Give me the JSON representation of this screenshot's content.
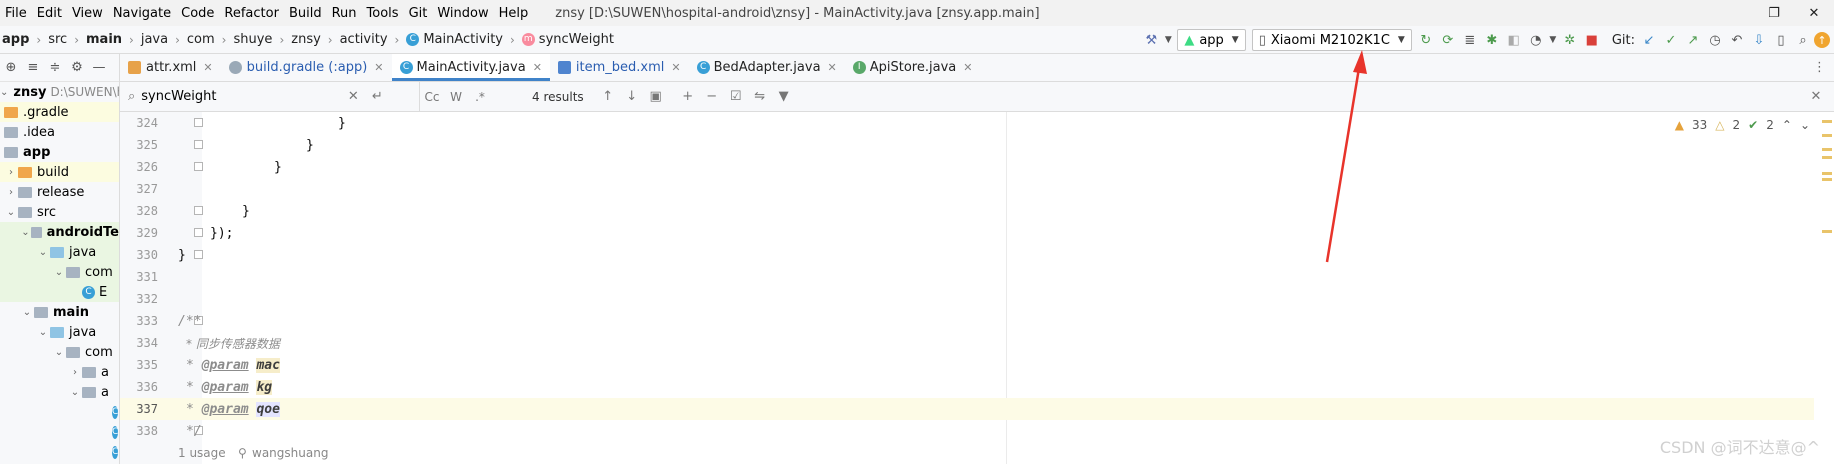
{
  "menubar": {
    "items": [
      "File",
      "Edit",
      "View",
      "Navigate",
      "Code",
      "Refactor",
      "Build",
      "Run",
      "Tools",
      "Git",
      "Window",
      "Help"
    ],
    "window_title": "znsy [D:\\SUWEN\\hospital-android\\znsy] - MainActivity.java [znsy.app.main]"
  },
  "navbar": {
    "breadcrumbs": [
      "app",
      "src",
      "main",
      "java",
      "com",
      "shuye",
      "znsy",
      "activity",
      "MainActivity",
      "syncWeight"
    ],
    "run_config": "app",
    "device": "Xiaomi M2102K1C",
    "git_label": "Git:"
  },
  "sidebar": {
    "items": [
      {
        "label": "znsy",
        "suffix": "D:\\SUWEN\\ho"
      },
      {
        "label": ".gradle"
      },
      {
        "label": ".idea"
      },
      {
        "label": "app"
      },
      {
        "label": "build"
      },
      {
        "label": "release"
      },
      {
        "label": "src"
      },
      {
        "label": "androidTe"
      },
      {
        "label": "java"
      },
      {
        "label": "com"
      },
      {
        "label": "E"
      },
      {
        "label": "main"
      },
      {
        "label": "java"
      },
      {
        "label": "com"
      },
      {
        "label": "a"
      },
      {
        "label": "a"
      }
    ]
  },
  "tabs": [
    {
      "label": "attr.xml"
    },
    {
      "label": "build.gradle (:app)"
    },
    {
      "label": "MainActivity.java"
    },
    {
      "label": "item_bed.xml"
    },
    {
      "label": "BedAdapter.java"
    },
    {
      "label": "ApiStore.java"
    }
  ],
  "find": {
    "query": "syncWeight",
    "results": "4 results",
    "opt_case": "Cc",
    "opt_word": "W",
    "opt_regex": ".*"
  },
  "inspections": {
    "warnings": "33",
    "weak_warnings": "2",
    "typos": "2"
  },
  "code": {
    "lines": [
      {
        "n": "324",
        "text": "}"
      },
      {
        "n": "325",
        "text": "}"
      },
      {
        "n": "326",
        "text": "}"
      },
      {
        "n": "327",
        "text": ""
      },
      {
        "n": "328",
        "text": "}"
      },
      {
        "n": "329",
        "text": "});"
      },
      {
        "n": "330",
        "text": "}"
      },
      {
        "n": "331",
        "text": ""
      },
      {
        "n": "332",
        "text": ""
      },
      {
        "n": "333",
        "text": "/**"
      },
      {
        "n": "334",
        "text": "* 同步传感器数据"
      },
      {
        "n": "335",
        "tag": "@param",
        "param": "mac"
      },
      {
        "n": "336",
        "tag": "@param",
        "param": "kg"
      },
      {
        "n": "337",
        "tag": "@param",
        "param": "qoe"
      },
      {
        "n": "338",
        "text": "*/"
      }
    ],
    "usage_hint": "1 usage",
    "author_hint": "wangshuang"
  },
  "watermark": "CSDN @词不达意@^",
  "colors": {
    "accent": "#4083c9",
    "annotation_arrow": "#e8342b",
    "current_line": "#fdfbe6"
  }
}
